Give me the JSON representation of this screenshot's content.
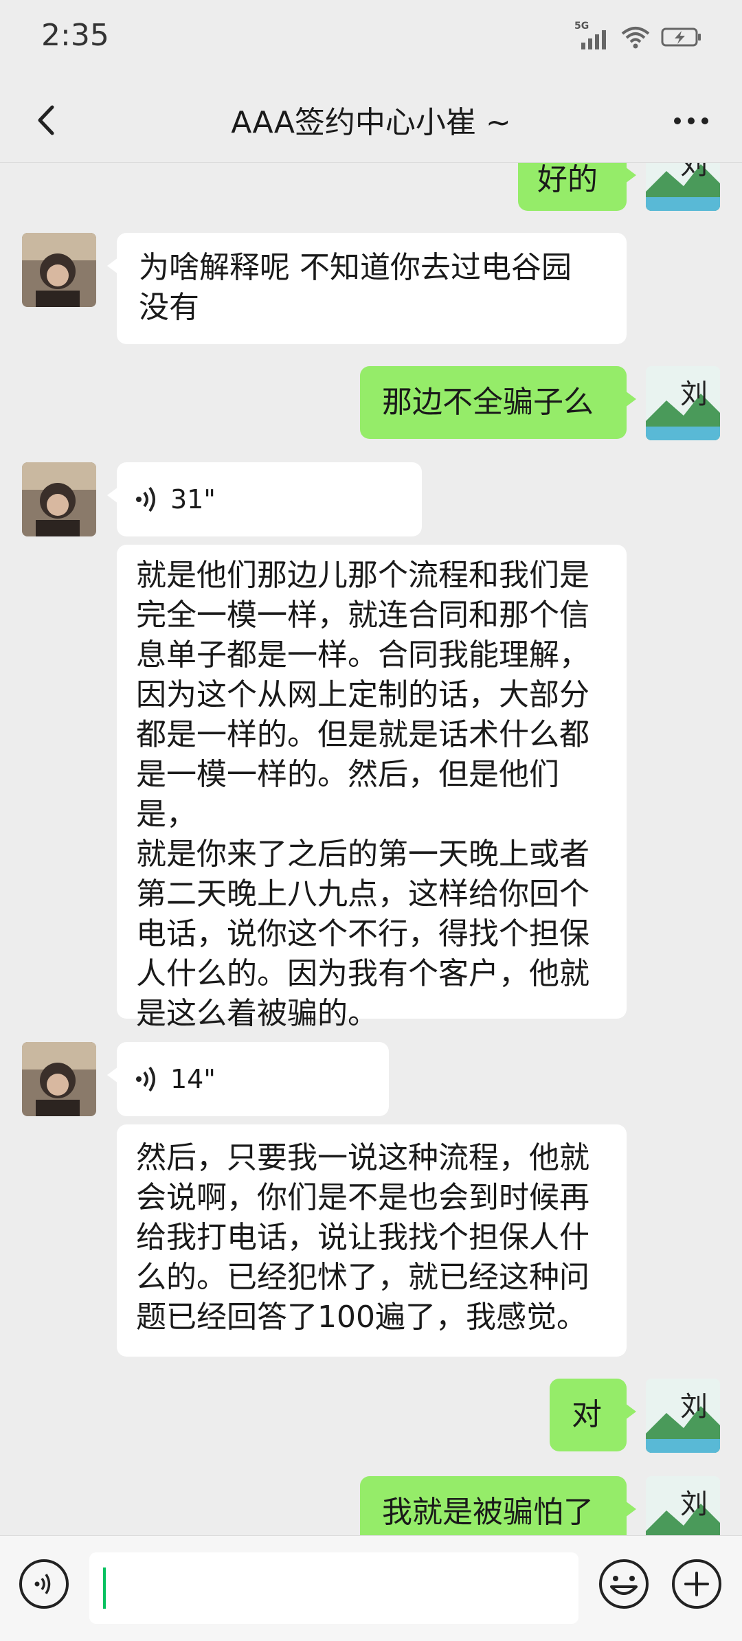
{
  "status_bar": {
    "time": "2:35",
    "network": "5G",
    "icons": [
      "signal-icon",
      "wifi-icon",
      "battery-charging-icon"
    ]
  },
  "header": {
    "back_icon": "chevron-left-icon",
    "title": "AAA签约中心小崔 ~",
    "more_icon": "ellipsis-icon"
  },
  "messages": [
    {
      "side": "out",
      "type": "text",
      "text": "好的"
    },
    {
      "side": "in",
      "type": "text",
      "lines": [
        "为啥解释呢 不知道你去过电谷园",
        "没有"
      ]
    },
    {
      "side": "out",
      "type": "text",
      "text": "那边不全骗子么"
    },
    {
      "side": "in",
      "type": "voice",
      "duration": "31\""
    },
    {
      "side": "in",
      "type": "transcript",
      "lines": [
        "就是他们那边儿那个流程和我们是",
        "完全一模一样，就连合同和那个信",
        "息单子都是一样。合同我能理解，",
        "因为这个从网上定制的话，大部分",
        "都是一样的。但是就是话术什么都",
        "是一模一样的。然后，但是他们是，",
        "就是你来了之后的第一天晚上或者",
        "第二天晚上八九点，这样给你回个",
        "电话，说你这个不行，得找个担保",
        "人什么的。因为我有个客户，他就",
        "是这么着被骗的。"
      ]
    },
    {
      "side": "in",
      "type": "voice",
      "duration": "14\""
    },
    {
      "side": "in",
      "type": "transcript",
      "lines": [
        "然后，只要我一说这种流程，他就",
        "会说啊，你们是不是也会到时候再",
        "给我打电话，说让我找个担保人什",
        "么的。已经犯怵了，就已经这种问",
        "题已经回答了100遍了，我感觉。"
      ]
    },
    {
      "side": "out",
      "type": "text",
      "text": "对"
    },
    {
      "side": "out",
      "type": "text",
      "text": "我就是被骗怕了"
    }
  ],
  "input_bar": {
    "voice_icon": "voice-input-icon",
    "input_value": "",
    "emoji_icon": "emoji-icon",
    "plus_icon": "plus-icon"
  },
  "colors": {
    "background": "#ededed",
    "outgoing_bubble": "#95ec69",
    "incoming_bubble": "#ffffff",
    "caret": "#07c160"
  }
}
